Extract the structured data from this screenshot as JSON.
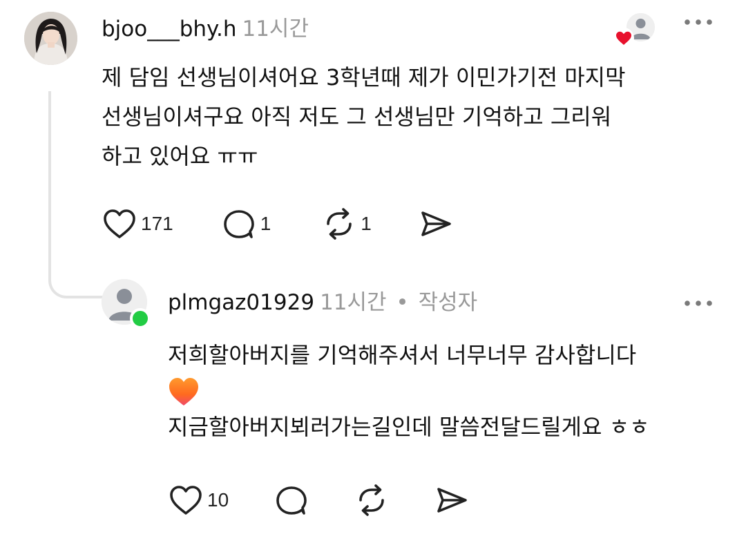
{
  "comment": {
    "username": "bjoo___bhy.h",
    "time": "11시간",
    "text_lines": [
      "제 담임 선생님이셔어요 3학년때 제가 이민가기전 마지막",
      "선생님이셔구요 아직 저도 그 선생님만 기억하고 그리워",
      "하고 있어요 ㅠㅠ"
    ],
    "likes": "171",
    "replies": "1",
    "reposts": "1"
  },
  "reply": {
    "username": "plmgaz01929",
    "time": "11시간",
    "separator": "•",
    "author_tag": "작성자",
    "line1": "저희할아버지를 기억해주셔서 너무너무 감사합니다",
    "line2": "지금할아버지뵈러가는길인데 말씀전달드릴게요 ㅎㅎ",
    "likes": "10"
  },
  "icons": {
    "avatar": "profile-photo",
    "like": "heart-outline-icon",
    "reply": "speech-bubble-icon",
    "repost": "repost-arrows-icon",
    "share": "send-icon",
    "more": "more-dots-icon"
  },
  "colors": {
    "online": "#22cc44",
    "heart_badge": "#e8112d",
    "muted": "#999999"
  }
}
